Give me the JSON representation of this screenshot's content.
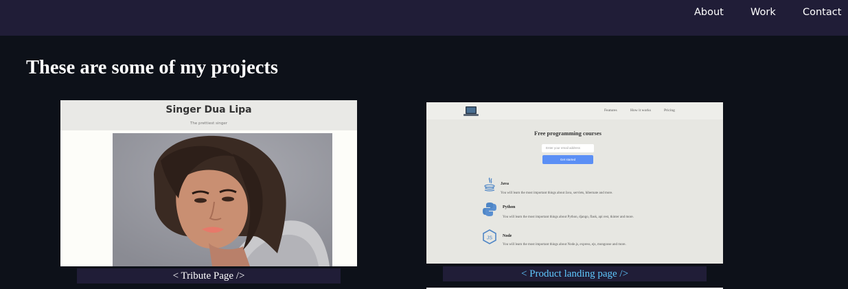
{
  "nav": {
    "links": [
      {
        "label": "About"
      },
      {
        "label": "Work"
      },
      {
        "label": "Contact"
      }
    ]
  },
  "projects_section": {
    "title": "These are some of my projects"
  },
  "projects": [
    {
      "caption": "< Tribute Page />",
      "preview": {
        "title": "Singer Dua Lipa",
        "subtitle": "The prettiest singer"
      }
    },
    {
      "caption": "< Product landing page />",
      "preview": {
        "nav": [
          "Features",
          "How it works",
          "Pricing"
        ],
        "hero": "Free programming courses",
        "email_placeholder": "Enter your email address",
        "button": "Get started",
        "features": [
          {
            "title": "Java",
            "icon": "java-icon",
            "desc": "You will learn the most important things about Java, servlets, hibernate and more."
          },
          {
            "title": "Python",
            "icon": "python-icon",
            "desc": "You will learn the most important things about Python, django, flask, api rest, tkinter and more."
          },
          {
            "title": "Node",
            "icon": "nodejs-icon",
            "desc": "You will learn the most important things about Node.js, express, ejs, mongoose and more."
          }
        ]
      }
    }
  ],
  "colors": {
    "page_bg": "#0d1119",
    "nav_bg": "#201d37",
    "caption_bg": "#201d37",
    "caption_link": "#5fc8ff"
  }
}
